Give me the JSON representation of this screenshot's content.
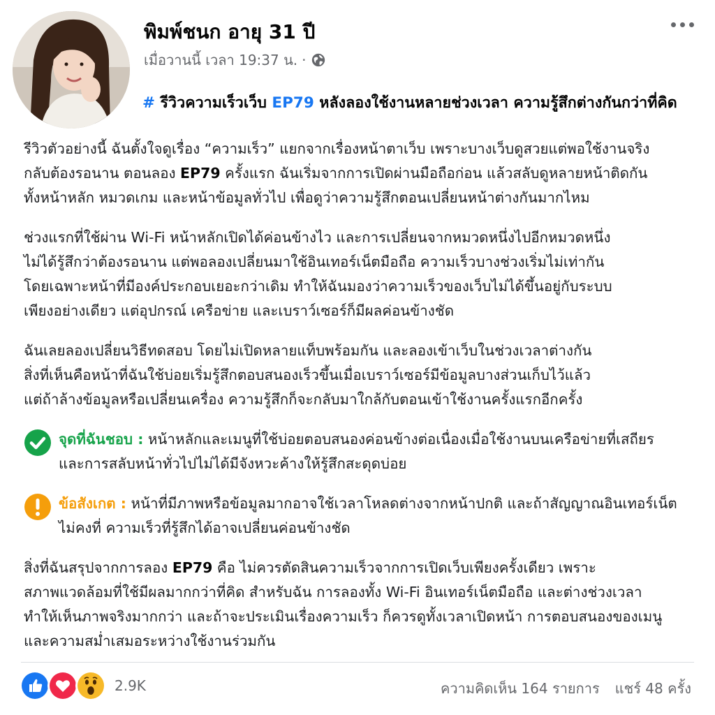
{
  "post": {
    "author": "พิมพ์ชนก อายุ 31 ปี",
    "timestamp": "เมื่อวานนี้ เวลา 19:37 น.",
    "meta_separator": "·",
    "headline_hash": "#",
    "headline_pre": " รีวิวความเร็วเว็บ ",
    "headline_ep": "EP79",
    "headline_post": " หลังลองใช้งานหลายช่วงเวลา ความรู้สึกต่างกันกว่าที่คิด",
    "paragraph1": {
      "line1": "รีวิวตัวอย่างนี้ ฉันตั้งใจดูเรื่อง “ความเร็ว” แยกจากเรื่องหน้าตาเว็บ เพราะบางเว็บดูสวยแต่พอใช้งานจริง",
      "line2_pre": "กลับต้องรอนาน ตอนลอง ",
      "line2_kw": "EP79",
      "line2_post": " ครั้งแรก ฉันเริ่มจากการเปิดผ่านมือถือก่อน แล้วสลับดูหลายหน้าติดกัน",
      "line3": "ทั้งหน้าหลัก หมวดเกม และหน้าข้อมูลทั่วไป เพื่อดูว่าความรู้สึกตอนเปลี่ยนหน้าต่างกันมากไหม"
    },
    "paragraph2": [
      "ช่วงแรกที่ใช้ผ่าน Wi-Fi หน้าหลักเปิดได้ค่อนข้างไว และการเปลี่ยนจากหมวดหนึ่งไปอีกหมวดหนึ่ง",
      "ไม่ได้รู้สึกว่าต้องรอนาน แต่พอลองเปลี่ยนมาใช้อินเทอร์เน็ตมือถือ ความเร็วบางช่วงเริ่มไม่เท่ากัน",
      "โดยเฉพาะหน้าที่มีองค์ประกอบเยอะกว่าเดิม ทำให้ฉันมองว่าความเร็วของเว็บไม่ได้ขึ้นอยู่กับระบบ",
      "เพียงอย่างเดียว แต่อุปกรณ์ เครือข่าย และเบราว์เซอร์ก็มีผลค่อนข้างชัด"
    ],
    "paragraph3": [
      "ฉันเลยลองเปลี่ยนวิธีทดสอบ โดยไม่เปิดหลายแท็บพร้อมกัน และลองเข้าเว็บในช่วงเวลาต่างกัน",
      "สิ่งที่เห็นคือหน้าที่ฉันใช้บ่อยเริ่มรู้สึกตอบสนองเร็วขึ้นเมื่อเบราว์เซอร์มีข้อมูลบางส่วนเก็บไว้แล้ว",
      "แต่ถ้าล้างข้อมูลหรือเปลี่ยนเครื่อง ความรู้สึกก็จะกลับมาใกล้กับตอนเข้าใช้งานครั้งแรกอีกครั้ง"
    ],
    "like_note": {
      "label": "จุดที่ฉันชอบ :",
      "line1": " หน้าหลักและเมนูที่ใช้บ่อยตอบสนองค่อนข้างต่อเนื่องเมื่อใช้งานบนเครือข่ายที่เสถียร",
      "line2": "และการสลับหน้าทั่วไปไม่ได้มีจังหวะค้างให้รู้สึกสะดุดบ่อย"
    },
    "warn_note": {
      "label": "ข้อสังเกต :",
      "line1": " หน้าที่มีภาพหรือข้อมูลมากอาจใช้เวลาโหลดต่างจากหน้าปกติ และถ้าสัญญาณอินเทอร์เน็ต",
      "line2": "ไม่คงที่ ความเร็วที่รู้สึกได้อาจเปลี่ยนค่อนข้างชัด"
    },
    "paragraph4": {
      "line1_pre": "สิ่งที่ฉันสรุปจากการลอง ",
      "line1_kw": "EP79",
      "line1_post": " คือ ไม่ควรตัดสินความเร็วจากการเปิดเว็บเพียงครั้งเดียว เพราะ",
      "line2": "สภาพแวดล้อมที่ใช้มีผลมากกว่าที่คิด สำหรับฉัน การลองทั้ง Wi-Fi อินเทอร์เน็ตมือถือ และต่างช่วงเวลา",
      "line3": "ทำให้เห็นภาพจริงมากกว่า และถ้าจะประเมินเรื่องความเร็ว ก็ควรดูทั้งเวลาเปิดหน้า การตอบสนองของเมนู",
      "line4": "และความสม่ำเสมอระหว่างใช้งานร่วมกัน"
    }
  },
  "footer": {
    "reaction_count": "2.9K",
    "comments": "ความคิดเห็น 164 รายการ",
    "shares": "แชร์ 48 ครั้ง"
  },
  "colors": {
    "accent": "#1877f2",
    "like_green": "#16a34a",
    "warn_amber": "#f59e0b",
    "love_red": "#f0284a"
  },
  "icons": [
    "more-options-icon",
    "globe-icon",
    "check-circle-icon",
    "warning-circle-icon",
    "like-reaction-icon",
    "love-reaction-icon",
    "wow-reaction-icon"
  ]
}
